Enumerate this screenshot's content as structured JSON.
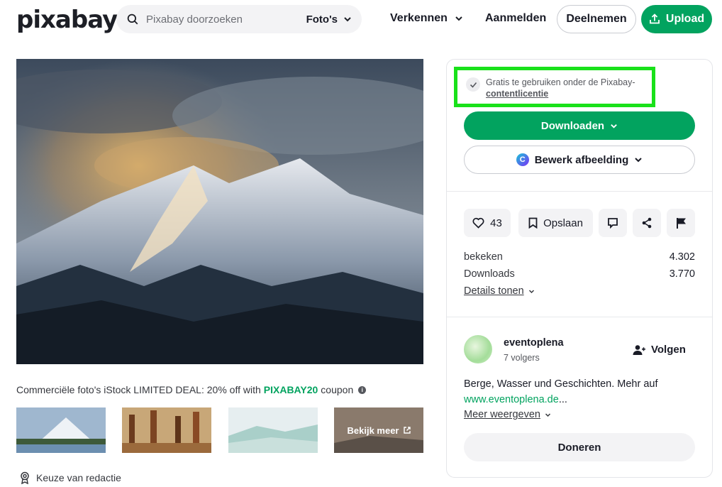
{
  "header": {
    "logo": "pixabay",
    "search_placeholder": "Pixabay doorzoeken",
    "search_type": "Foto's",
    "explore": "Verkennen",
    "login": "Aanmelden",
    "join": "Deelnemen",
    "upload": "Upload"
  },
  "promo": {
    "text": "Commerciële foto's iStock LIMITED DEAL: 20% off with",
    "code": "PIXABAY20",
    "suffix": "coupon"
  },
  "thumbs": {
    "more_label": "Bekijk meer"
  },
  "editor_choice": "Keuze van redactie",
  "sidebar": {
    "license_text": "Gratis te gebruiken onder de Pixabay-",
    "license_link": "contentlicentie",
    "download": "Downloaden",
    "edit": "Bewerk afbeelding",
    "likes": "43",
    "save": "Opslaan",
    "stats": [
      {
        "label": "bekeken",
        "value": "4.302"
      },
      {
        "label": "Downloads",
        "value": "3.770"
      }
    ],
    "details": "Details tonen",
    "user": {
      "name": "eventoplena",
      "followers": "7 volgers",
      "follow": "Volgen",
      "bio_text": "Berge, Wasser und Geschichten. Mehr auf",
      "bio_url": "www.eventoplena.de",
      "bio_ellipsis": "...",
      "more": "Meer weergeven"
    },
    "donate": "Doneren"
  },
  "colors": {
    "brand_green": "#02a35f",
    "highlight": "#19e11a"
  }
}
